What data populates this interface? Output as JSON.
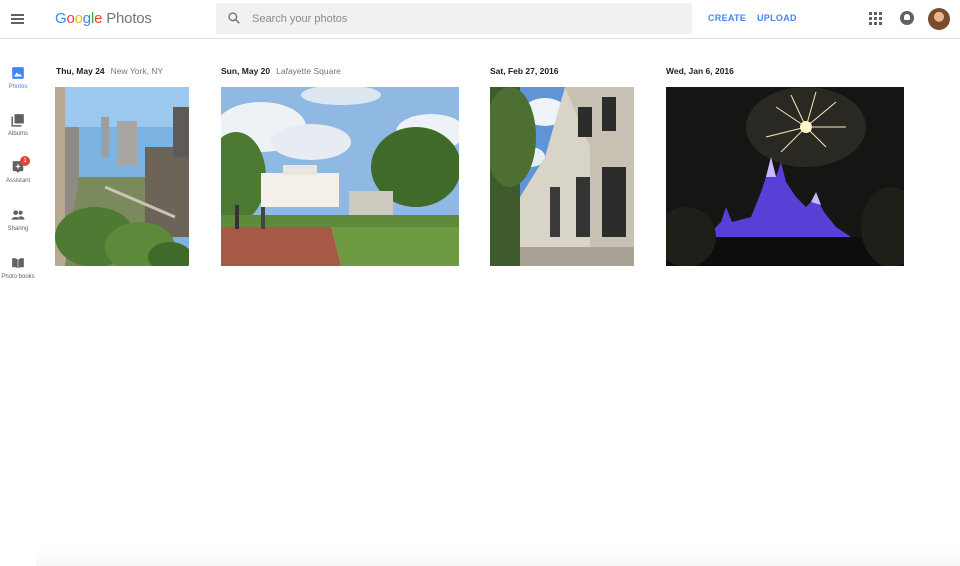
{
  "app": {
    "logo_google": [
      "G",
      "o",
      "o",
      "g",
      "l",
      "e"
    ],
    "logo_product": "Photos"
  },
  "search": {
    "placeholder": "Search your photos",
    "value": ""
  },
  "actions": {
    "create": "CREATE",
    "upload": "UPLOAD"
  },
  "sidebar": {
    "items": [
      {
        "label": "Photos",
        "icon": "photo-icon",
        "active": true
      },
      {
        "label": "Albums",
        "icon": "albums-icon"
      },
      {
        "label": "Assistant",
        "icon": "assistant-icon",
        "badge": "1"
      },
      {
        "label": "Sharing",
        "icon": "people-icon"
      },
      {
        "label": "Photo books",
        "icon": "book-icon"
      }
    ]
  },
  "groups": [
    {
      "date": "Thu, May 24",
      "place": "New York, NY"
    },
    {
      "date": "Sun, May 20",
      "place": "Lafayette Square"
    },
    {
      "date": "Sat, Feb 27, 2016",
      "place": ""
    },
    {
      "date": "Wed, Jan 6, 2016",
      "place": ""
    }
  ],
  "colors": {
    "accent": "#4285f4",
    "badge": "#db4437",
    "icon": "#616161"
  }
}
